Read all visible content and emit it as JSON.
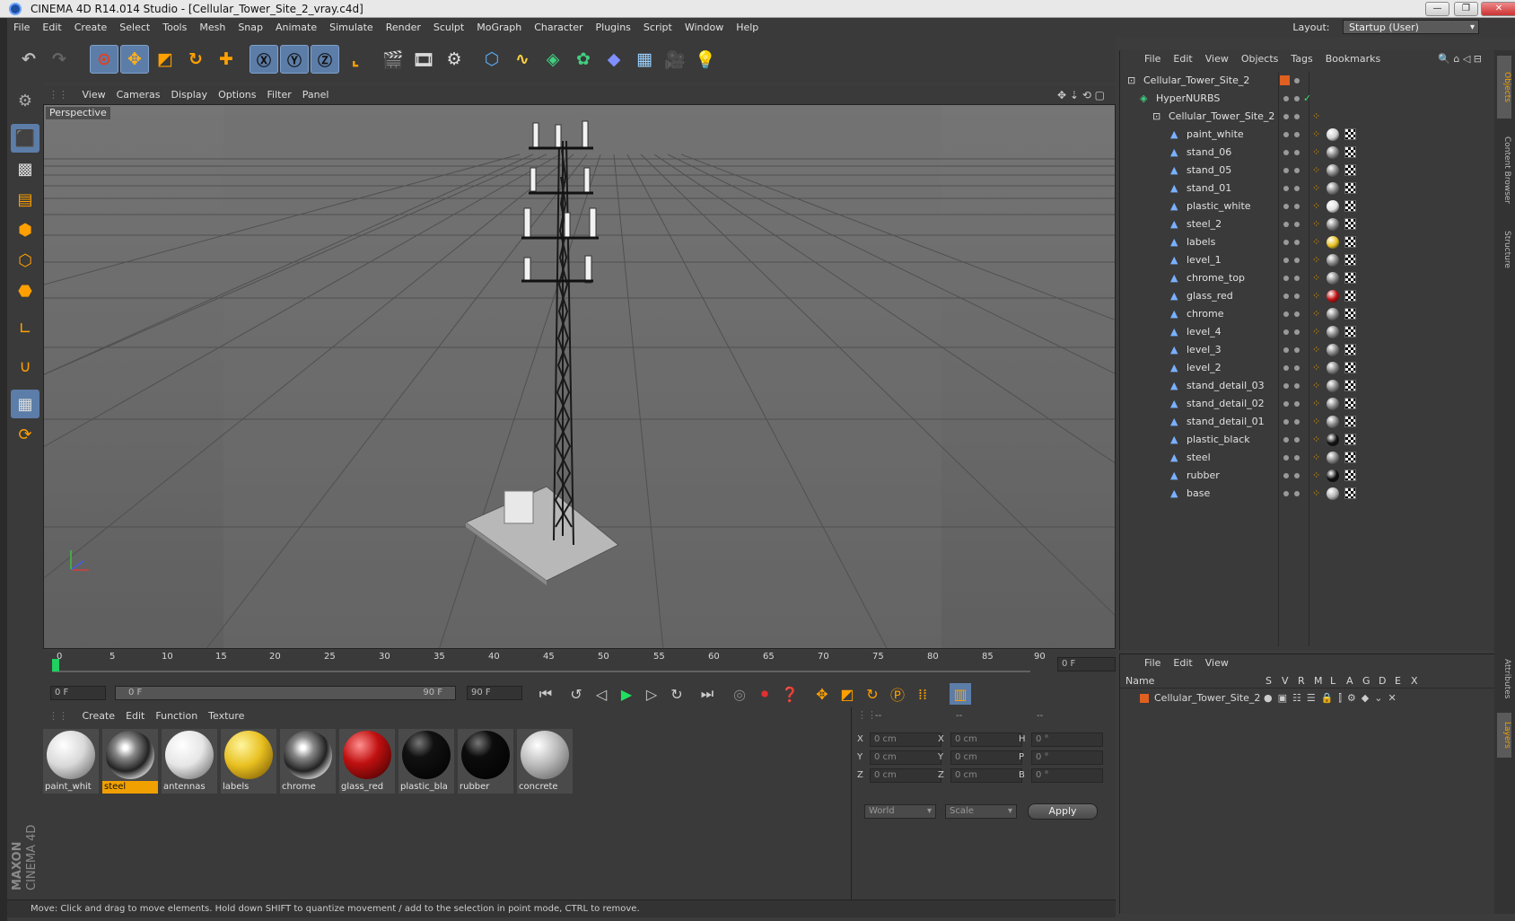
{
  "window": {
    "title": "CINEMA 4D R14.014 Studio - [Cellular_Tower_Site_2_vray.c4d]",
    "buttons": {
      "minimize": "—",
      "restore": "❐",
      "close": "✕"
    }
  },
  "menubar": {
    "items": [
      "File",
      "Edit",
      "Create",
      "Select",
      "Tools",
      "Mesh",
      "Snap",
      "Animate",
      "Simulate",
      "Render",
      "Sculpt",
      "MoGraph",
      "Character",
      "Plugins",
      "Script",
      "Window",
      "Help"
    ],
    "layout_label": "Layout:",
    "layout_value": "Startup (User)"
  },
  "viewport": {
    "menu": [
      "View",
      "Cameras",
      "Display",
      "Options",
      "Filter",
      "Panel"
    ],
    "label": "Perspective"
  },
  "timeline": {
    "ticks": [
      "0",
      "5",
      "10",
      "15",
      "20",
      "25",
      "30",
      "35",
      "40",
      "45",
      "50",
      "55",
      "60",
      "65",
      "70",
      "75",
      "80",
      "85",
      "90"
    ],
    "frame_field": "0 F",
    "start_field": "0 F",
    "range_start": "0 F",
    "range_end": "90 F",
    "end_field": "90 F"
  },
  "materials": {
    "menu": [
      "Create",
      "Edit",
      "Function",
      "Texture"
    ],
    "items": [
      {
        "name": "paint_whit",
        "color": "#d9d9d9",
        "style": "matte"
      },
      {
        "name": "steel",
        "color": "#9a9a9a",
        "style": "chrome",
        "selected": true
      },
      {
        "name": "antennas",
        "color": "#e6e6e6",
        "style": "matte"
      },
      {
        "name": "labels",
        "color": "#e8c020",
        "style": "yellow"
      },
      {
        "name": "chrome",
        "color": "#a8a8a8",
        "style": "chrome"
      },
      {
        "name": "glass_red",
        "color": "#c01010",
        "style": "red"
      },
      {
        "name": "plastic_bla",
        "color": "#111111",
        "style": "black"
      },
      {
        "name": "rubber",
        "color": "#0c0c0c",
        "style": "black"
      },
      {
        "name": "concrete",
        "color": "#b8b8b8",
        "style": "matte"
      }
    ]
  },
  "coords": {
    "headers": [
      "--",
      "--",
      "--"
    ],
    "rows": [
      {
        "a": "X",
        "av": "0 cm",
        "b": "X",
        "bv": "0 cm",
        "c": "H",
        "cv": "0 °"
      },
      {
        "a": "Y",
        "av": "0 cm",
        "b": "Y",
        "bv": "0 cm",
        "c": "P",
        "cv": "0 °"
      },
      {
        "a": "Z",
        "av": "0 cm",
        "b": "Z",
        "bv": "0 cm",
        "c": "B",
        "cv": "0 °"
      }
    ],
    "mode1": "World",
    "mode2": "Scale",
    "apply": "Apply"
  },
  "status": "Move: Click and drag to move elements. Hold down SHIFT to quantize movement / add to the selection in point mode, CTRL to remove.",
  "objects": {
    "menu": [
      "File",
      "Edit",
      "View",
      "Objects",
      "Tags",
      "Bookmarks"
    ],
    "tree": [
      {
        "name": "Cellular_Tower_Site_2",
        "level": 0,
        "type": "null"
      },
      {
        "name": "HyperNURBS",
        "level": 1,
        "type": "nurbs"
      },
      {
        "name": "Cellular_Tower_Site_2",
        "level": 2,
        "type": "null"
      },
      {
        "name": "paint_white",
        "level": 3,
        "type": "poly",
        "tag": "#d0d0d0"
      },
      {
        "name": "stand_06",
        "level": 3,
        "type": "poly",
        "tag": "#808080"
      },
      {
        "name": "stand_05",
        "level": 3,
        "type": "poly",
        "tag": "#808080"
      },
      {
        "name": "stand_01",
        "level": 3,
        "type": "poly",
        "tag": "#808080"
      },
      {
        "name": "plastic_white",
        "level": 3,
        "type": "poly",
        "tag": "#e0e0e0"
      },
      {
        "name": "steel_2",
        "level": 3,
        "type": "poly",
        "tag": "#808080"
      },
      {
        "name": "labels",
        "level": 3,
        "type": "poly",
        "tag": "#e8c020"
      },
      {
        "name": "level_1",
        "level": 3,
        "type": "poly",
        "tag": "#808080"
      },
      {
        "name": "chrome_top",
        "level": 3,
        "type": "poly",
        "tag": "#808080"
      },
      {
        "name": "glass_red",
        "level": 3,
        "type": "poly",
        "tag": "#c01010"
      },
      {
        "name": "chrome",
        "level": 3,
        "type": "poly",
        "tag": "#808080"
      },
      {
        "name": "level_4",
        "level": 3,
        "type": "poly",
        "tag": "#808080"
      },
      {
        "name": "level_3",
        "level": 3,
        "type": "poly",
        "tag": "#808080"
      },
      {
        "name": "level_2",
        "level": 3,
        "type": "poly",
        "tag": "#808080"
      },
      {
        "name": "stand_detail_03",
        "level": 3,
        "type": "poly",
        "tag": "#808080"
      },
      {
        "name": "stand_detail_02",
        "level": 3,
        "type": "poly",
        "tag": "#808080"
      },
      {
        "name": "stand_detail_01",
        "level": 3,
        "type": "poly",
        "tag": "#808080"
      },
      {
        "name": "plastic_black",
        "level": 3,
        "type": "poly",
        "tag": "#111111"
      },
      {
        "name": "steel",
        "level": 3,
        "type": "poly",
        "tag": "#808080"
      },
      {
        "name": "rubber",
        "level": 3,
        "type": "poly",
        "tag": "#0c0c0c"
      },
      {
        "name": "base",
        "level": 3,
        "type": "poly",
        "tag": "#b0b0b0"
      }
    ]
  },
  "layers": {
    "menu": [
      "File",
      "Edit",
      "View"
    ],
    "columns": [
      "Name",
      "S",
      "V",
      "R",
      "M",
      "L",
      "A",
      "G",
      "D",
      "E",
      "X"
    ],
    "row": "Cellular_Tower_Site_2"
  },
  "side_tabs": [
    "Objects",
    "Content Browser",
    "Structure",
    "Attributes",
    "Layers"
  ],
  "logo": [
    "MAXON",
    "CINEMA 4D"
  ]
}
